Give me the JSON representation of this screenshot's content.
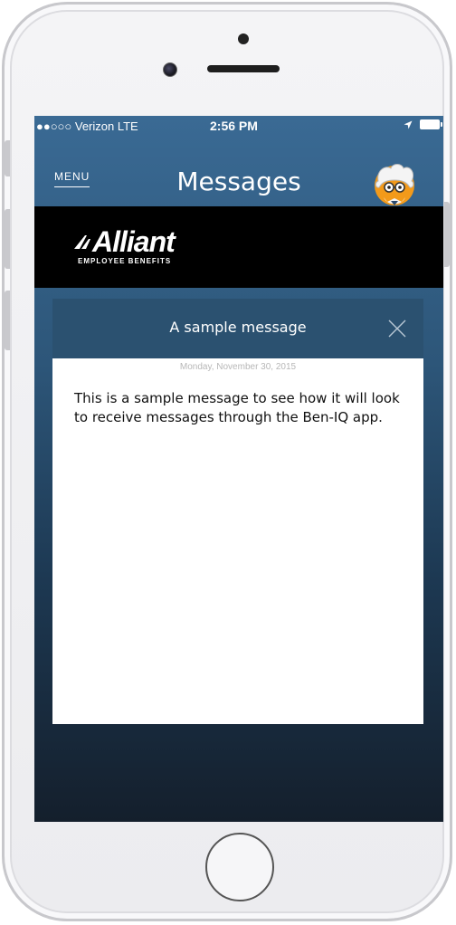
{
  "status_bar": {
    "carrier": "●●○○○ Verizon  LTE",
    "time": "2:56 PM",
    "location_icon": "location-arrow-icon",
    "battery_icon": "battery-icon"
  },
  "nav": {
    "menu_label": "MENU",
    "title": "Messages",
    "avatar_icon": "avatar-icon"
  },
  "brand": {
    "name": "Alliant",
    "subtitle": "EMPLOYEE BENEFITS"
  },
  "message": {
    "title": "A sample message",
    "date": "Monday, November 30, 2015",
    "body": "This is a sample message to see how it will look to receive messages through the Ben-IQ app.",
    "close_icon": "close-icon"
  },
  "colors": {
    "header_blue": "#2b5170",
    "screen_top": "#3a6a94",
    "screen_bottom": "#141f2c",
    "brand_bar": "#000000",
    "date_text": "#b7b7b7"
  }
}
